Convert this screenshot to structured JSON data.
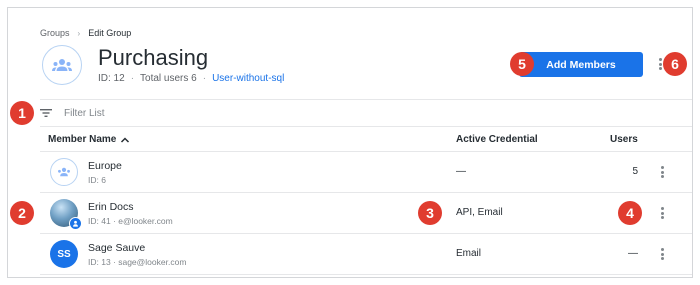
{
  "breadcrumb": {
    "parent": "Groups",
    "separator": "›",
    "current": "Edit Group"
  },
  "group": {
    "name": "Purchasing",
    "id_text": "ID: 12",
    "separator": "·",
    "total_users_text": "Total users 6",
    "link_text": "User-without-sql"
  },
  "toolbar": {
    "add_members_label": "Add Members"
  },
  "filter": {
    "placeholder": "Filter List"
  },
  "table": {
    "columns": {
      "name": "Member Name",
      "credential": "Active Credential",
      "users": "Users"
    },
    "sort_indicator": "^",
    "rows": [
      {
        "avatar_type": "group",
        "name": "Europe",
        "sub": "ID: 6",
        "credential": "—",
        "users": "5"
      },
      {
        "avatar_type": "photo",
        "name": "Erin Docs",
        "sub": "ID: 41 · e@looker.com",
        "credential": "API, Email",
        "users": ""
      },
      {
        "avatar_type": "initials",
        "initials": "SS",
        "name": "Sage Sauve",
        "sub": "ID: 13 · sage@looker.com",
        "credential": "Email",
        "users": "—"
      }
    ]
  },
  "callouts": [
    "1",
    "2",
    "3",
    "4",
    "5",
    "6"
  ],
  "colors": {
    "accent": "#1a73e8",
    "callout": "#e03c2f",
    "avatar_border": "#b8d3f3"
  },
  "icons": [
    "group-icon",
    "filter-icon",
    "sort-ascending-icon",
    "kebab-menu-icon",
    "user-badge-icon"
  ]
}
